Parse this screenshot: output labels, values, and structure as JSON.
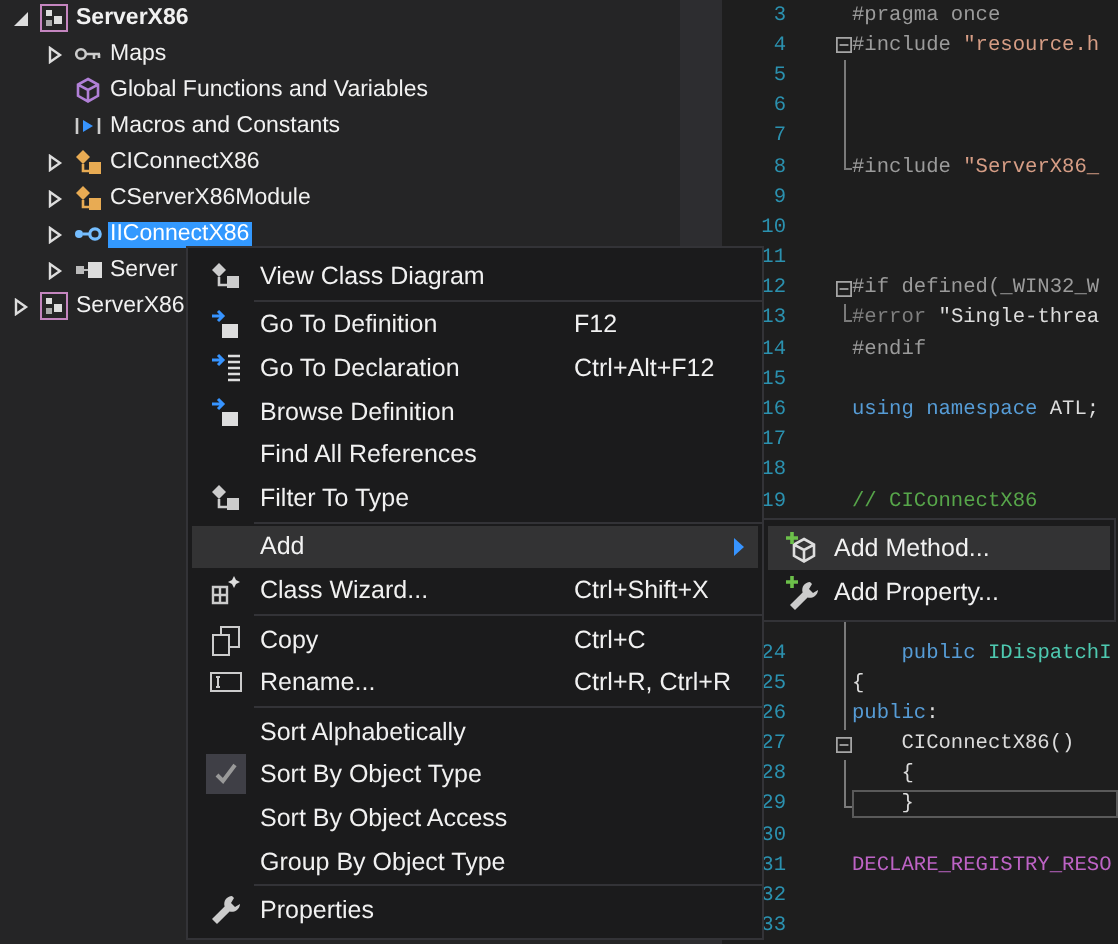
{
  "solution_tree": {
    "items": [
      {
        "label": "ServerX86",
        "kind": "project",
        "bold": true,
        "selected": false,
        "expandable": true,
        "expanded": true,
        "children": [
          {
            "label": "Maps",
            "kind": "maps",
            "bold": false,
            "selected": false,
            "expandable": true,
            "expanded": false
          },
          {
            "label": "Global Functions and Variables",
            "kind": "globals",
            "bold": false,
            "selected": false,
            "expandable": false
          },
          {
            "label": "Macros and Constants",
            "kind": "macros",
            "bold": false,
            "selected": false,
            "expandable": false
          },
          {
            "label": "CIConnectX86",
            "kind": "class",
            "bold": false,
            "selected": false,
            "expandable": true,
            "expanded": false
          },
          {
            "label": "CServerX86Module",
            "kind": "class",
            "bold": false,
            "selected": false,
            "expandable": true,
            "expanded": false
          },
          {
            "label": "IIConnectX86",
            "kind": "interface",
            "bold": false,
            "selected": true,
            "expandable": true,
            "expanded": false
          },
          {
            "label": "Server",
            "kind": "module",
            "bold": false,
            "selected": false,
            "expandable": true,
            "expanded": false
          }
        ]
      },
      {
        "label": "ServerX86",
        "kind": "project",
        "bold": false,
        "selected": false,
        "expandable": true,
        "expanded": false
      }
    ]
  },
  "editor": {
    "lines": [
      {
        "number": "3",
        "kind": "plain",
        "tokens": [
          {
            "text": "#pragma once",
            "kind": "preproc"
          }
        ]
      },
      {
        "number": "4",
        "kind": "fold_start",
        "tokens": [
          {
            "text": "#include ",
            "kind": "preproc"
          },
          {
            "text": "\"resource.h",
            "kind": "string"
          }
        ]
      },
      {
        "number": "5",
        "kind": "fold_inside"
      },
      {
        "number": "6",
        "kind": "fold_inside"
      },
      {
        "number": "7",
        "kind": "fold_inside"
      },
      {
        "number": "8",
        "kind": "fold_end",
        "tokens": [
          {
            "text": "#include ",
            "kind": "preproc"
          },
          {
            "text": "\"ServerX86_",
            "kind": "string"
          }
        ]
      },
      {
        "number": "9",
        "kind": "plain"
      },
      {
        "number": "10",
        "kind": "plain"
      },
      {
        "number": "11",
        "kind": "plain"
      },
      {
        "number": "12",
        "kind": "fold_start",
        "tokens": [
          {
            "text": "#if defined(_WIN32_W",
            "kind": "preproc"
          }
        ]
      },
      {
        "number": "13",
        "kind": "fold_end",
        "tokens": [
          {
            "text": "#error ",
            "kind": "inactive"
          },
          {
            "text": "\"Single-threa",
            "kind": "plain"
          }
        ]
      },
      {
        "number": "14",
        "kind": "plain",
        "tokens": [
          {
            "text": "#endif",
            "kind": "preproc"
          }
        ]
      },
      {
        "number": "15",
        "kind": "plain"
      },
      {
        "number": "16",
        "kind": "plain",
        "tokens": [
          {
            "text": "using namespace",
            "kind": "keyword"
          },
          {
            "text": " ATL;",
            "kind": "plain"
          }
        ]
      },
      {
        "number": "17",
        "kind": "plain"
      },
      {
        "number": "18",
        "kind": "plain"
      },
      {
        "number": "19",
        "kind": "plain",
        "tokens": [
          {
            "text": "// CIConnectX86",
            "kind": "comment"
          }
        ]
      },
      {
        "kind": "plain"
      },
      {
        "kind": "plain"
      },
      {
        "kind": "plain"
      },
      {
        "kind": "fold_inside"
      },
      {
        "number": "24",
        "kind": "fold_inside",
        "tokens": [
          {
            "text": "    public",
            "kind": "keyword"
          },
          {
            "text": " IDispatchI",
            "kind": "type"
          }
        ]
      },
      {
        "number": "25",
        "kind": "fold_inside",
        "tokens": [
          {
            "text": "{",
            "kind": "plain"
          }
        ]
      },
      {
        "number": "26",
        "kind": "fold_inside",
        "tokens": [
          {
            "text": "public",
            "kind": "keyword"
          },
          {
            "text": ":",
            "kind": "plain"
          }
        ]
      },
      {
        "number": "27",
        "kind": "fold_start",
        "tokens": [
          {
            "text": "    CIConnectX86()",
            "kind": "plain"
          }
        ]
      },
      {
        "number": "28",
        "kind": "fold_inside",
        "tokens": [
          {
            "text": "    {",
            "kind": "plain"
          }
        ]
      },
      {
        "number": "29",
        "kind": "fold_end",
        "current": true,
        "tokens": [
          {
            "text": "    }",
            "kind": "plain"
          }
        ]
      },
      {
        "number": "30",
        "kind": "plain"
      },
      {
        "number": "31",
        "kind": "plain",
        "tokens": [
          {
            "text": "DECLARE_REGISTRY_RESO",
            "kind": "macro"
          }
        ]
      },
      {
        "number": "32",
        "kind": "plain"
      },
      {
        "number": "33",
        "kind": "plain"
      }
    ]
  },
  "context_menu": {
    "items": [
      {
        "kind": "diagram",
        "label": "View Class Diagram",
        "selected": false,
        "checked": false,
        "submenu": false
      },
      {
        "kind": "separator"
      },
      {
        "kind": "go_definition",
        "label": "Go To Definition",
        "shortcut": "F12",
        "selected": false,
        "checked": false,
        "submenu": false
      },
      {
        "kind": "go_declaration",
        "label": "Go To Declaration",
        "shortcut": "Ctrl+Alt+F12",
        "selected": false,
        "checked": false,
        "submenu": false
      },
      {
        "kind": "go_definition",
        "label": "Browse Definition",
        "selected": false,
        "checked": false,
        "submenu": false
      },
      {
        "kind": "plain",
        "label": "Find All References",
        "selected": false,
        "checked": false,
        "submenu": false
      },
      {
        "kind": "diagram",
        "label": "Filter To Type",
        "selected": false,
        "checked": false,
        "submenu": false
      },
      {
        "kind": "separator"
      },
      {
        "kind": "plain",
        "label": "Add",
        "selected": true,
        "checked": false,
        "submenu": true
      },
      {
        "kind": "wizard",
        "label": "Class Wizard...",
        "shortcut": "Ctrl+Shift+X",
        "selected": false,
        "checked": false,
        "submenu": false
      },
      {
        "kind": "separator"
      },
      {
        "kind": "copy",
        "label": "Copy",
        "shortcut": "Ctrl+C",
        "selected": false,
        "checked": false,
        "submenu": false
      },
      {
        "kind": "rename",
        "label": "Rename...",
        "shortcut": "Ctrl+R, Ctrl+R",
        "selected": false,
        "checked": false,
        "submenu": false
      },
      {
        "kind": "separator"
      },
      {
        "kind": "plain",
        "label": "Sort Alphabetically",
        "selected": false,
        "checked": false,
        "submenu": false
      },
      {
        "kind": "plain",
        "label": "Sort By Object Type",
        "selected": false,
        "checked": true,
        "submenu": false
      },
      {
        "kind": "plain",
        "label": "Sort By Object Access",
        "selected": false,
        "checked": false,
        "submenu": false
      },
      {
        "kind": "plain",
        "label": "Group By Object Type",
        "selected": false,
        "checked": false,
        "submenu": false
      },
      {
        "kind": "separator"
      },
      {
        "kind": "properties",
        "label": "Properties",
        "selected": false,
        "checked": false,
        "submenu": false
      }
    ]
  },
  "submenu": {
    "items": [
      {
        "kind": "add_method",
        "label": "Add Method...",
        "selected": true
      },
      {
        "kind": "add_property",
        "label": "Add Property...",
        "selected": false
      }
    ]
  }
}
